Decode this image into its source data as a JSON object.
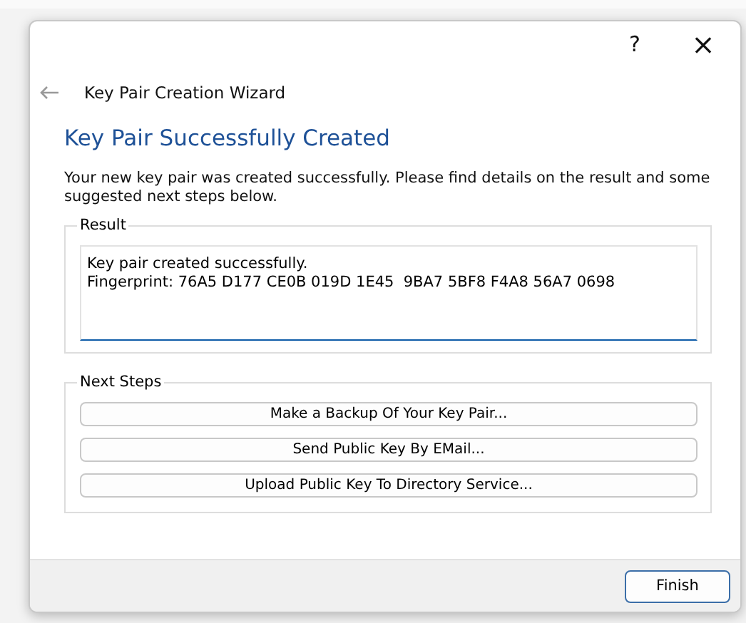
{
  "window": {
    "help": "?",
    "close": "×"
  },
  "wizard": {
    "title": "Key Pair Creation Wizard"
  },
  "page": {
    "heading": "Key Pair Successfully Created",
    "description": "Your new key pair was created successfully. Please find details on the result and some suggested next steps below."
  },
  "result": {
    "label": "Result",
    "value": "Key pair created successfully.\nFingerprint: 76A5 D177 CE0B 019D 1E45  9BA7 5BF8 F4A8 56A7 0698"
  },
  "next_steps": {
    "label": "Next Steps",
    "buttons": [
      "Make a Backup Of Your Key Pair...",
      "Send Public Key By EMail...",
      "Upload Public Key To Directory Service..."
    ]
  },
  "footer": {
    "buttons": [
      "Finish"
    ]
  }
}
